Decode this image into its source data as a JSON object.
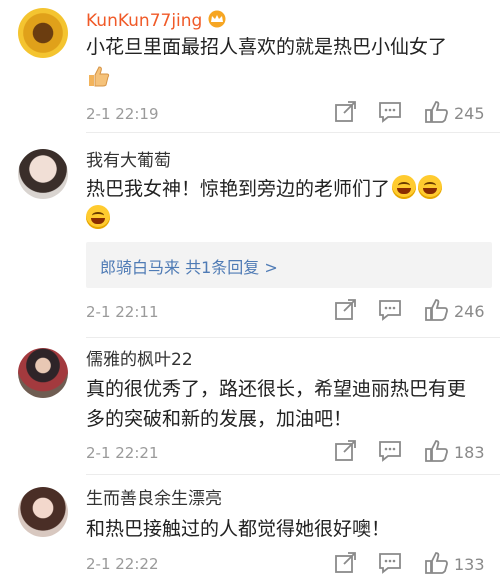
{
  "comments": [
    {
      "user": "KunKun77jing",
      "text": "小花旦里面最招人喜欢的就是热巴小仙女了",
      "time": "2-1 22:19",
      "likes": "245"
    },
    {
      "user": "我有大葡萄",
      "text": "热巴我女神！惊艳到旁边的老师们了",
      "reply": "郎骑白马来 共1条回复 >",
      "time": "2-1 22:11",
      "likes": "246"
    },
    {
      "user": "儒雅的枫叶22",
      "text": "真的很优秀了，路还很长，希望迪丽热巴有更多的突破和新的发展，加油吧！",
      "time": "2-1 22:21",
      "likes": "183"
    },
    {
      "user": "生而善良余生漂亮",
      "text": "和热巴接触过的人都觉得她很好噢！",
      "time": "2-1 22:22",
      "likes": "133"
    }
  ],
  "colors": {
    "vip_name": "#f05a28",
    "name": "#333333",
    "reply_link": "#4f7bb5",
    "meta": "#9a9a9a"
  },
  "icons": [
    "crown-badge-icon",
    "thumbs-up-emoji-icon",
    "laugh-emoji-icon",
    "share-icon",
    "comment-icon",
    "like-icon"
  ]
}
